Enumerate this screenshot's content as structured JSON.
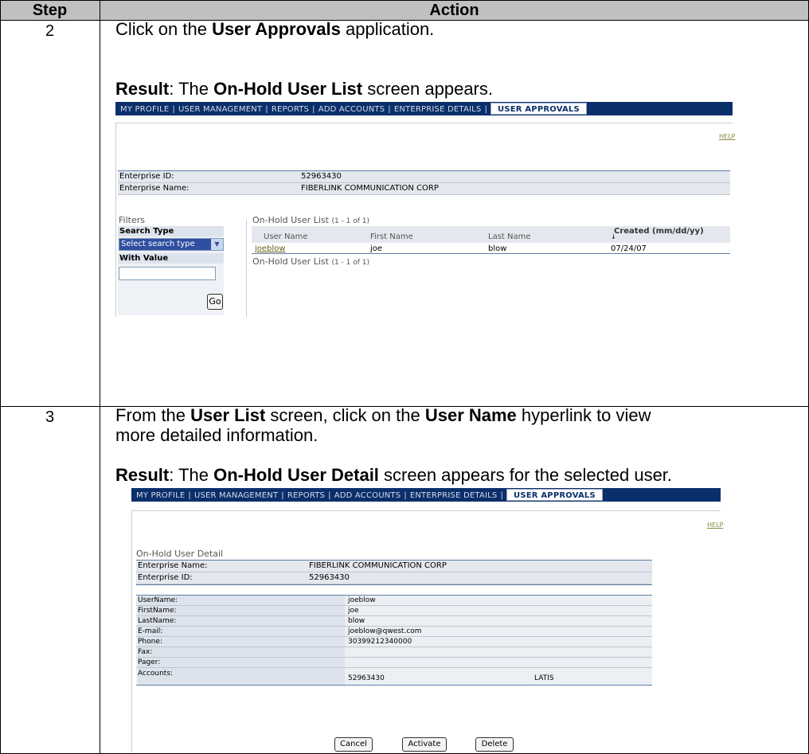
{
  "table": {
    "col_step": "Step",
    "col_action": "Action"
  },
  "step2": {
    "number": "2",
    "line1_pre": "Click on the ",
    "line1_bold": "User Approvals",
    "line1_post": " application.",
    "result_label": "Result",
    "result_pre": ":  The ",
    "result_bold": "On-Hold User List",
    "result_post": " screen appears."
  },
  "step3": {
    "number": "3",
    "line1_pre": "From the ",
    "line1_bold1": "User List",
    "line1_mid": " screen, click on the ",
    "line1_bold2": "User Name",
    "line1_post": " hyperlink to view",
    "line2": "more detailed information.",
    "result_label": "Result",
    "result_pre": ":  The ",
    "result_bold": "On-Hold User Detail",
    "result_post": " screen appears for the selected user."
  },
  "nav": {
    "items": [
      "MY PROFILE",
      "USER MANAGEMENT",
      "REPORTS",
      "ADD ACCOUNTS",
      "ENTERPRISE DETAILS"
    ],
    "active": "USER APPROVALS",
    "separator": "|"
  },
  "shot1": {
    "help": "HELP",
    "enterprise_id_label": "Enterprise ID:",
    "enterprise_id_value": "52963430",
    "enterprise_name_label": "Enterprise Name:",
    "enterprise_name_value": "FIBERLINK COMMUNICATION CORP",
    "filters_title": "Filters",
    "search_type_label": "Search Type",
    "search_type_selected": "Select search type",
    "with_value_label": "With Value",
    "with_value_input": "",
    "go_button": "Go",
    "list_title": "On-Hold User List",
    "list_count": "(1 - 1 of 1)",
    "columns": [
      "User Name",
      "First Name",
      "Last Name",
      "Created (mm/dd/yy)"
    ],
    "rows": [
      {
        "user_name": "joeblow",
        "first_name": "joe",
        "last_name": "blow",
        "created": "07/24/07"
      }
    ],
    "list_footer_title": "On-Hold User List",
    "list_footer_count": "(1 - 1 of 1)"
  },
  "shot2": {
    "help": "HELP",
    "title": "On-Hold User Detail",
    "enterprise_name_label": "Enterprise Name:",
    "enterprise_name_value": "FIBERLINK COMMUNICATION CORP",
    "enterprise_id_label": "Enterprise ID:",
    "enterprise_id_value": "52963430",
    "fields": [
      {
        "label": "UserName:",
        "value": "joeblow"
      },
      {
        "label": "FirstName:",
        "value": "joe"
      },
      {
        "label": "LastName:",
        "value": "blow"
      },
      {
        "label": "E-mail:",
        "value": "joeblow@qwest.com"
      },
      {
        "label": "Phone:",
        "value": "30399212340000"
      },
      {
        "label": "Fax:",
        "value": ""
      },
      {
        "label": "Pager:",
        "value": ""
      }
    ],
    "accounts_label": "Accounts:",
    "accounts_value": "52963430",
    "accounts_type": "LATIS",
    "buttons": {
      "cancel": "Cancel",
      "activate": "Activate",
      "delete": "Delete"
    }
  }
}
